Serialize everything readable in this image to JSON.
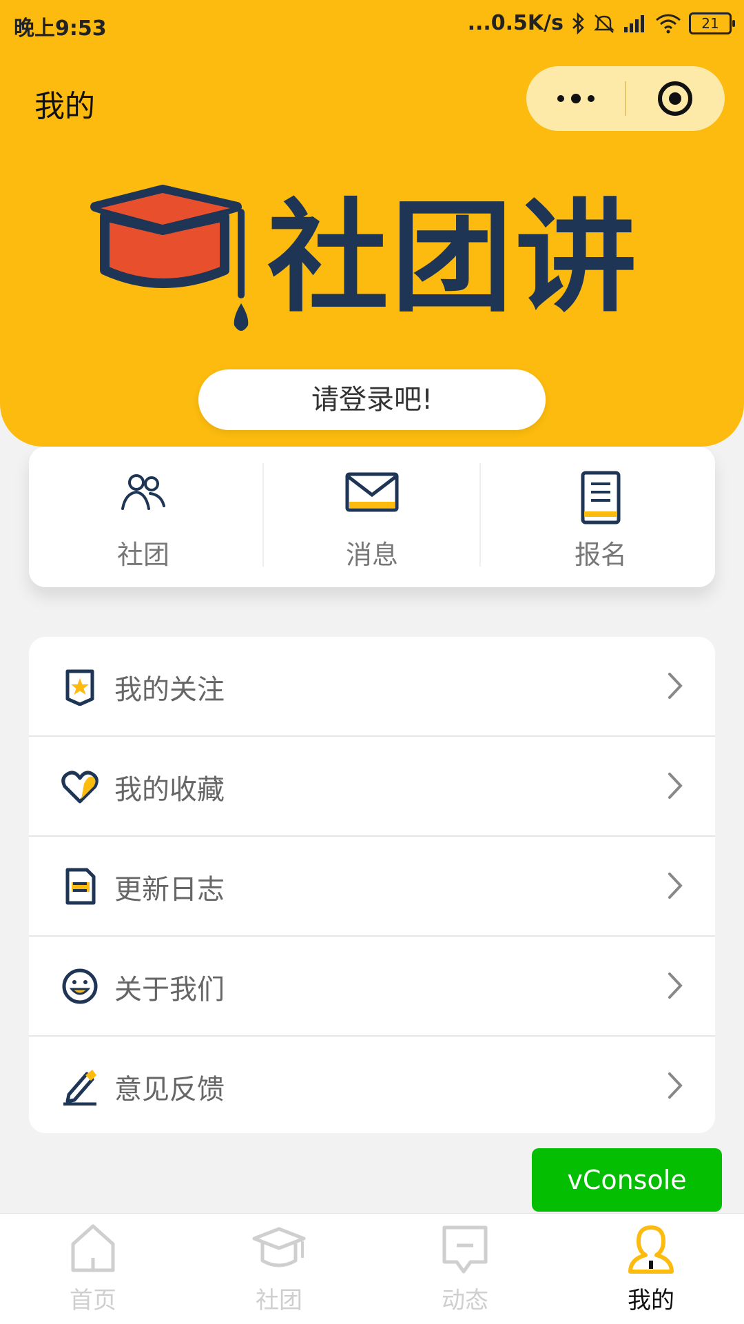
{
  "status_bar": {
    "time": "晚上9:53",
    "network_speed": "...0.5K/s",
    "battery": "21",
    "icons": [
      "bluetooth-icon",
      "mute-icon",
      "signal-icon",
      "wifi-icon",
      "battery-icon"
    ]
  },
  "header": {
    "title": "我的",
    "capsule_icons": [
      "more-dots-icon",
      "close-target-icon"
    ],
    "background_color": "#fcbb0e"
  },
  "logo": {
    "text": "社团讲",
    "icon": "graduation-cap-icon",
    "text_color": "#1e3556"
  },
  "login_button": {
    "label": "请登录吧!"
  },
  "quick_actions": [
    {
      "label": "社团",
      "icon": "people-icon"
    },
    {
      "label": "消息",
      "icon": "envelope-icon"
    },
    {
      "label": "报名",
      "icon": "document-book-icon"
    }
  ],
  "menu": [
    {
      "label": "我的关注",
      "icon": "star-badge-icon"
    },
    {
      "label": "我的收藏",
      "icon": "heart-icon"
    },
    {
      "label": "更新日志",
      "icon": "log-file-icon"
    },
    {
      "label": "关于我们",
      "icon": "smiley-icon"
    },
    {
      "label": "意见反馈",
      "icon": "pencil-icon"
    }
  ],
  "vconsole": {
    "label": "vConsole",
    "color": "#04be02"
  },
  "tabbar": {
    "tabs": [
      {
        "label": "首页",
        "icon": "home-icon",
        "active": false
      },
      {
        "label": "社团",
        "icon": "graduation-cap-icon",
        "active": false
      },
      {
        "label": "动态",
        "icon": "chat-bubble-icon",
        "active": false
      },
      {
        "label": "我的",
        "icon": "user-icon",
        "active": true
      }
    ],
    "accent_color": "#fcbb0e"
  }
}
